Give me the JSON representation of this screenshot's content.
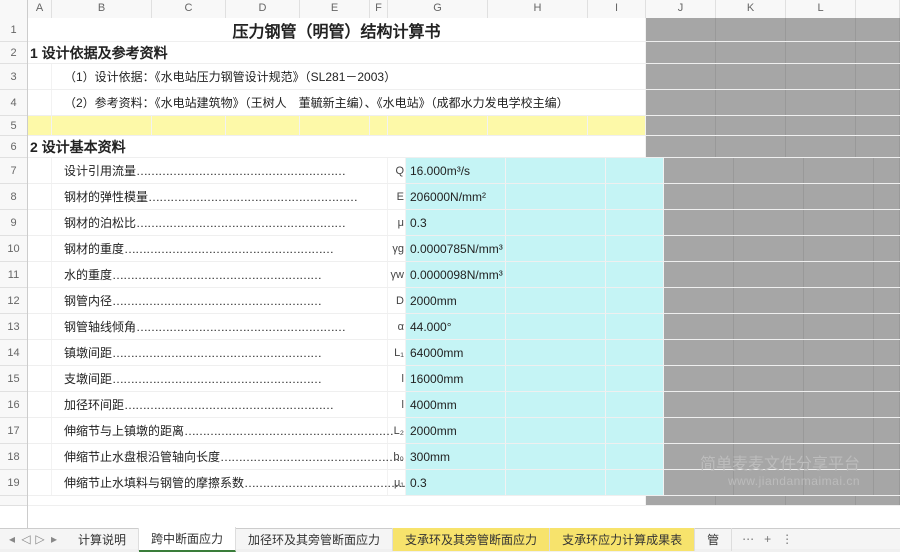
{
  "columns": [
    "A",
    "B",
    "C",
    "D",
    "E",
    "F",
    "G",
    "H",
    "I",
    "J",
    "K",
    "L"
  ],
  "rows": [
    "1",
    "2",
    "3",
    "4",
    "5",
    "6",
    "7",
    "8",
    "9",
    "10",
    "11",
    "12",
    "13",
    "14",
    "15",
    "16",
    "17",
    "18",
    "19"
  ],
  "title": "压力钢管（明管）结构计算书",
  "sec1": {
    "head": "1 设计依据及参考资料",
    "line1": "（1）设计依据：《水电站压力钢管设计规范》（SL281－2003）",
    "line2": "（2）参考资料：《水电站建筑物》（王树人　董毓新主编）、《水电站》（成都水力发电学校主编）"
  },
  "sec2": {
    "head": "2 设计基本资料"
  },
  "params": [
    {
      "label": "设计引用流量",
      "sym": "Q",
      "val": "16.000m³/s"
    },
    {
      "label": "钢材的弹性模量",
      "sym": "E",
      "val": "206000N/mm²"
    },
    {
      "label": "钢材的泊松比",
      "sym": "μ",
      "val": "0.3"
    },
    {
      "label": "钢材的重度",
      "sym": "γg",
      "val": "0.0000785N/mm³"
    },
    {
      "label": "水的重度",
      "sym": "γw",
      "val": "0.0000098N/mm³"
    },
    {
      "label": "钢管内径",
      "sym": "D",
      "val": "2000mm"
    },
    {
      "label": "钢管轴线倾角",
      "sym": "α",
      "val": "44.000°"
    },
    {
      "label": "镇墩间距",
      "sym": "L₁",
      "val": "64000mm"
    },
    {
      "label": "支墩间距",
      "sym": "l",
      "val": "16000mm"
    },
    {
      "label": "加径环间距",
      "sym": "l",
      "val": "4000mm"
    },
    {
      "label": "伸缩节与上镇墩的距离",
      "sym": "L₂",
      "val": "2000mm"
    },
    {
      "label": "伸缩节止水盘根沿管轴向长度",
      "sym": "b₀",
      "val": "300mm"
    },
    {
      "label": "伸缩节止水填料与钢管的摩擦系数",
      "sym": "μ₁",
      "val": "0.3"
    }
  ],
  "dots": "…………………………………………………",
  "watermark": {
    "line1": "简单麦麦文件分享平台",
    "line2": "www.jiandanmaimai.cn"
  },
  "tabs": {
    "nav": [
      "◂",
      "◁",
      "▷",
      "▸"
    ],
    "items": [
      {
        "label": "计算说明",
        "cls": ""
      },
      {
        "label": "跨中断面应力",
        "cls": "active"
      },
      {
        "label": "加径环及其旁管断面应力",
        "cls": ""
      },
      {
        "label": "支承环及其旁管断面应力",
        "cls": "hl1"
      },
      {
        "label": "支承环应力计算成果表",
        "cls": "hl2"
      },
      {
        "label": "管",
        "cls": ""
      }
    ],
    "more": [
      "⋯",
      "+",
      "⋮"
    ]
  }
}
